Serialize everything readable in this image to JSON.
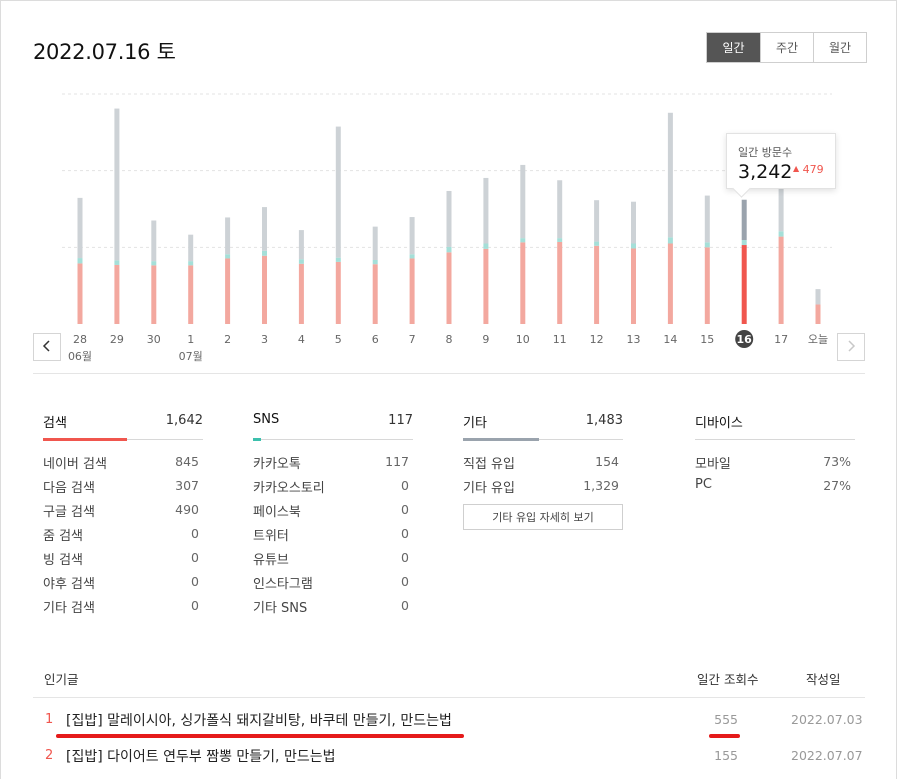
{
  "header": {
    "date_title": "2022.07.16 토",
    "period_tabs": [
      {
        "label": "일간",
        "active": true
      },
      {
        "label": "주간",
        "active": false
      },
      {
        "label": "월간",
        "active": false
      }
    ]
  },
  "navigation": {
    "prev_icon": "chevron-left-icon",
    "next_icon": "chevron-right-icon"
  },
  "chart_data": {
    "type": "bar",
    "categories": [
      "28",
      "29",
      "30",
      "1",
      "2",
      "3",
      "4",
      "5",
      "6",
      "7",
      "8",
      "9",
      "10",
      "11",
      "12",
      "13",
      "14",
      "15",
      "16",
      "17",
      "오늘"
    ],
    "month_labels": [
      {
        "index": 0,
        "label": "06월"
      },
      {
        "index": 3,
        "label": "07월"
      }
    ],
    "selected_index": 18,
    "stacked": true,
    "series": [
      {
        "color": "#f3a89f",
        "selected_color": "#f0564e",
        "values": [
          1580,
          1540,
          1530,
          1530,
          1710,
          1780,
          1570,
          1620,
          1560,
          1710,
          1870,
          1960,
          2130,
          2140,
          2040,
          1970,
          2100,
          2000,
          2060,
          2280,
          510
        ]
      },
      {
        "color": "#a5dfd8",
        "values": [
          140,
          120,
          110,
          110,
          110,
          130,
          120,
          110,
          110,
          110,
          140,
          140,
          110,
          100,
          110,
          130,
          160,
          130,
          130,
          140,
          0
        ]
      },
      {
        "color": "#cdd2d6",
        "selected_color": "#9aa3ad",
        "values": [
          1570,
          3960,
          1060,
          690,
          960,
          1140,
          760,
          3420,
          870,
          970,
          1460,
          1710,
          1910,
          1510,
          1080,
          1090,
          3250,
          1220,
          1052,
          1400,
          400
        ]
      }
    ],
    "ylim": [
      0,
      6000
    ],
    "grid": true,
    "gridline_values": [
      2000,
      4000,
      6000
    ],
    "tooltip": {
      "label": "일간 방문수",
      "value": "3,242",
      "change": "479",
      "change_direction": "up"
    }
  },
  "stats": [
    {
      "title": "검색",
      "total": "1,642",
      "bar_color": "#f0564e",
      "bar_fraction": 0.53,
      "rows": [
        {
          "label": "네이버 검색",
          "value": "845"
        },
        {
          "label": "다음 검색",
          "value": "307"
        },
        {
          "label": "구글 검색",
          "value": "490"
        },
        {
          "label": "줌 검색",
          "value": "0"
        },
        {
          "label": "빙 검색",
          "value": "0"
        },
        {
          "label": "야후 검색",
          "value": "0"
        },
        {
          "label": "기타 검색",
          "value": "0"
        }
      ]
    },
    {
      "title": "SNS",
      "total": "117",
      "bar_color": "#3cc0ad",
      "bar_fraction": 0.05,
      "rows": [
        {
          "label": "카카오톡",
          "value": "117"
        },
        {
          "label": "카카오스토리",
          "value": "0"
        },
        {
          "label": "페이스북",
          "value": "0"
        },
        {
          "label": "트위터",
          "value": "0"
        },
        {
          "label": "유튜브",
          "value": "0"
        },
        {
          "label": "인스타그램",
          "value": "0"
        },
        {
          "label": "기타 SNS",
          "value": "0"
        }
      ]
    },
    {
      "title": "기타",
      "total": "1,483",
      "bar_color": "#9aa3ad",
      "bar_fraction": 0.48,
      "rows": [
        {
          "label": "직접 유입",
          "value": "154"
        },
        {
          "label": "기타 유입",
          "value": "1,329"
        }
      ],
      "button_label": "기타 유입 자세히 보기"
    },
    {
      "title": "디바이스",
      "total": "",
      "rows": [
        {
          "label": "모바일",
          "value": "73%"
        },
        {
          "label": "PC",
          "value": "27%"
        }
      ]
    }
  ],
  "popular": {
    "header": "인기글",
    "col_views": "일간 조회수",
    "col_date": "작성일",
    "rows": [
      {
        "rank": "1",
        "title": "[집밥] 말레이시아, 싱가폴식 돼지갈비탕, 바쿠테 만들기, 만드는법",
        "views": "555",
        "date": "2022.07.03"
      },
      {
        "rank": "2",
        "title": "[집밥] 다이어트 연두부 짬뽕 만들기, 만드는법",
        "views": "155",
        "date": "2022.07.07"
      }
    ]
  }
}
